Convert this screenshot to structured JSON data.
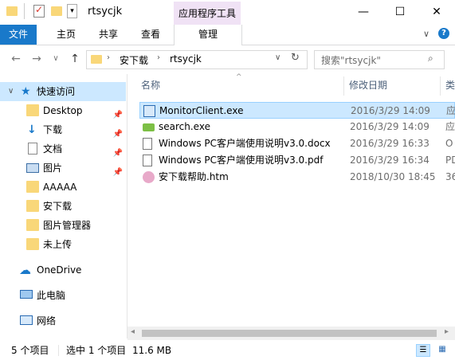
{
  "window": {
    "title": "rtsycjk",
    "context_tab_label": "应用程序工具",
    "minimize_label": "—",
    "maximize_label": "☐",
    "close_label": "✕"
  },
  "ribbon": {
    "file_tab": "文件",
    "tabs": [
      "主页",
      "共享",
      "查看"
    ],
    "context_tab": "管理"
  },
  "address": {
    "path": [
      "安下载",
      "rtsycjk"
    ],
    "search_placeholder": "搜索\"rtsycjk\""
  },
  "nav": {
    "quick_access": "快速访问",
    "items": [
      {
        "label": "Desktop",
        "icon": "folder-icon",
        "pinned": true
      },
      {
        "label": "下载",
        "icon": "download-icon",
        "pinned": true
      },
      {
        "label": "文档",
        "icon": "document-icon",
        "pinned": true
      },
      {
        "label": "图片",
        "icon": "pictures-icon",
        "pinned": true
      },
      {
        "label": "AAAAA",
        "icon": "folder-icon",
        "pinned": false
      },
      {
        "label": "安下载",
        "icon": "folder-icon",
        "pinned": false
      },
      {
        "label": "图片管理器",
        "icon": "folder-icon",
        "pinned": false
      },
      {
        "label": "未上传",
        "icon": "folder-icon",
        "pinned": false
      }
    ],
    "onedrive": "OneDrive",
    "this_pc": "此电脑",
    "network": "网络"
  },
  "columns": {
    "name": "名称",
    "date": "修改日期",
    "type": "类型"
  },
  "files": [
    {
      "name": "MonitorClient.exe",
      "date": "2016/3/29 14:09",
      "type": "应",
      "icon": "exe-icon",
      "selected": true
    },
    {
      "name": "search.exe",
      "date": "2016/3/29 14:09",
      "type": "应",
      "icon": "exe-icon",
      "selected": false
    },
    {
      "name": "Windows PC客户端使用说明v3.0.docx",
      "date": "2016/3/29 16:33",
      "type": "O",
      "icon": "docx-icon",
      "selected": false
    },
    {
      "name": "Windows PC客户端使用说明v3.0.pdf",
      "date": "2016/3/29 16:34",
      "type": "PD",
      "icon": "pdf-icon",
      "selected": false
    },
    {
      "name": "安下载帮助.htm",
      "date": "2018/10/30 18:45",
      "type": "36",
      "icon": "htm-icon",
      "selected": false
    }
  ],
  "status": {
    "item_count": "5 个项目",
    "selected": "选中 1 个项目",
    "size": "11.6 MB"
  },
  "colors": {
    "accent": "#1979ca",
    "selection": "#cce8ff",
    "context_tab": "#f0e2f5"
  }
}
